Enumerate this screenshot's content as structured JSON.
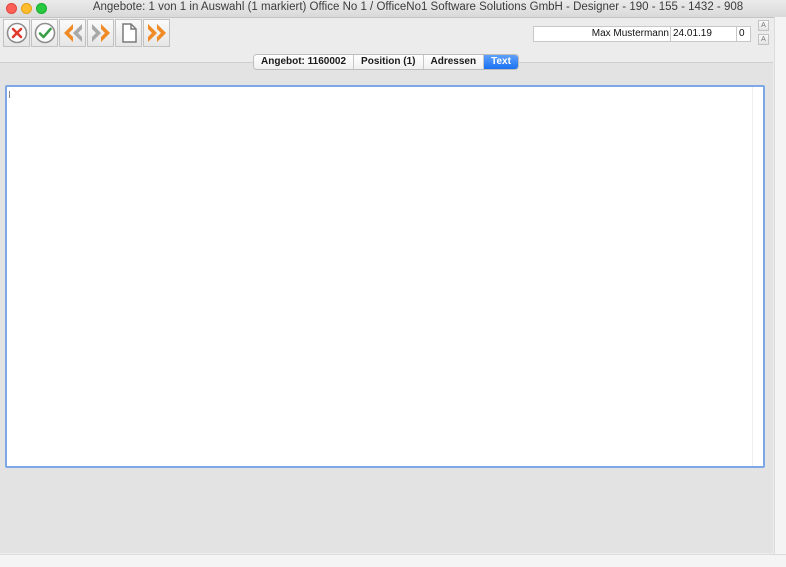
{
  "window": {
    "title": "Angebote: 1 von 1 in Auswahl  (1 markiert) Office No 1 /  OfficeNo1 Software Solutions GmbH - Designer - 190 - 155 - 1432 - 908"
  },
  "toolbar": {
    "buttons": [
      {
        "name": "cancel",
        "icon": "cancel-icon"
      },
      {
        "name": "confirm",
        "icon": "checkmark-icon"
      },
      {
        "name": "previous",
        "icon": "double-chevron-left-icon"
      },
      {
        "name": "next",
        "icon": "double-chevron-right-icon"
      },
      {
        "name": "document",
        "icon": "document-icon"
      },
      {
        "name": "forward",
        "icon": "double-chevron-right-icon"
      }
    ],
    "user_name": "Max Mustermann",
    "date": "24.01.19",
    "count": "0",
    "font_larger_label": "A",
    "font_smaller_label": "A"
  },
  "tabs": [
    {
      "label": "Angebot: 1160002",
      "active": false
    },
    {
      "label": "Position (1)",
      "active": false
    },
    {
      "label": "Adressen",
      "active": false
    },
    {
      "label": "Text",
      "active": true
    }
  ],
  "editor": {
    "value": ""
  },
  "colors": {
    "tab_active": "#2a7bf2",
    "focus_border": "#7ea7e6",
    "icon_orange": "#f08a24",
    "icon_red": "#e23b2e",
    "icon_green": "#3aa048"
  }
}
